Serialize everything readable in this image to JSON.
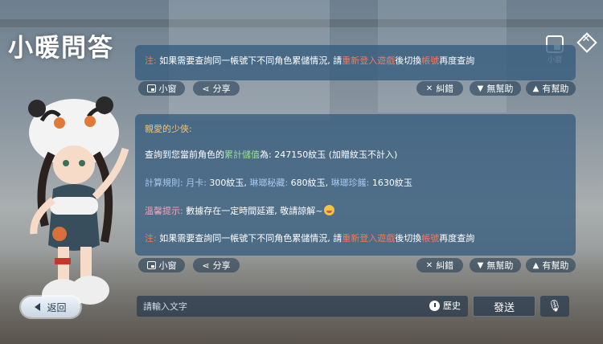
{
  "app": {
    "title": "小暖問答"
  },
  "topbar": {
    "mini_label": "小窗",
    "close_icon": "close-diamond-icon"
  },
  "cards": [
    {
      "lines": [
        [
          {
            "t": "注:",
            "c": "red"
          },
          {
            "t": " 如果需要查詢同一帳號下不同角色累儲情況, 請"
          },
          {
            "t": "重新登入遊戲",
            "c": "red"
          },
          {
            "t": "後切換"
          },
          {
            "t": "帳號",
            "c": "red"
          },
          {
            "t": "再度查詢"
          }
        ]
      ],
      "actions": {
        "mini": "小窗",
        "share": "分享",
        "report": "糾錯",
        "unhelpful": "無幫助",
        "helpful": "有幫助"
      }
    },
    {
      "lines": [
        [
          {
            "t": "親愛的少俠:",
            "c": "gold"
          }
        ],
        [
          {
            "t": "查詢到您當前角色的"
          },
          {
            "t": "累計儲值",
            "c": "green"
          },
          {
            "t": "為: 247150紋玉 (加贈紋玉不計入)"
          }
        ],
        [
          {
            "t": "計算規則:",
            "c": "blue"
          },
          {
            "t": " 月卡:",
            "c": "blue"
          },
          {
            "t": " 300紋玉,"
          },
          {
            "t": " 琳瑯秘藏:",
            "c": "blue"
          },
          {
            "t": " 680紋玉,"
          },
          {
            "t": " 琳瑯珍饈:",
            "c": "blue"
          },
          {
            "t": " 1630紋玉"
          }
        ],
        [
          {
            "t": "溫馨提示:",
            "c": "pink"
          },
          {
            "t": " 數據存在一定時間延遲, 敬請諒解~"
          },
          {
            "t": "",
            "c": "emoji"
          }
        ],
        [
          {
            "t": "注:",
            "c": "red"
          },
          {
            "t": " 如果需要查詢同一帳號下不同角色累儲情況, 請"
          },
          {
            "t": "重新登入遊戲",
            "c": "red"
          },
          {
            "t": "後切換"
          },
          {
            "t": "帳號",
            "c": "red"
          },
          {
            "t": "再度查詢"
          }
        ]
      ],
      "actions": {
        "mini": "小窗",
        "share": "分享",
        "report": "糾錯",
        "unhelpful": "無幫助",
        "helpful": "有幫助"
      }
    }
  ],
  "bottom": {
    "back_label": "返回",
    "input_placeholder": "請輸入文字",
    "history_label": "歷史",
    "send_label": "發送",
    "mic_icon": "microphone-icon"
  }
}
